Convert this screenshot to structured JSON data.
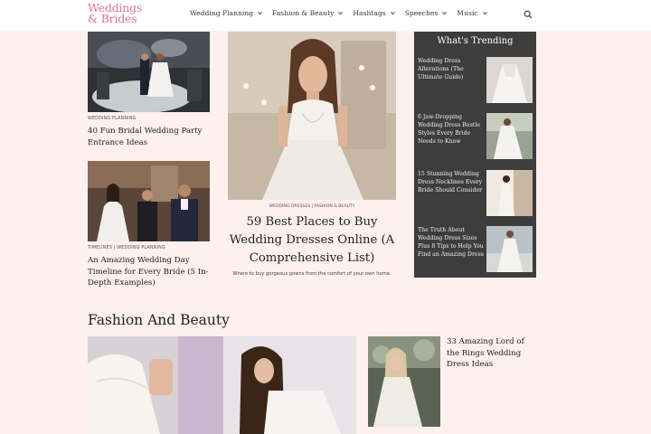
{
  "header": {
    "logo": "Weddings & Brides",
    "nav": [
      {
        "label": "Wedding Planning"
      },
      {
        "label": "Fashion & Beauty"
      },
      {
        "label": "Hashtags"
      },
      {
        "label": "Speeches"
      },
      {
        "label": "Music"
      }
    ],
    "search_icon": "search-icon"
  },
  "left_posts": [
    {
      "category": "WEDDING PLANNING",
      "title": "40 Fun Bridal Wedding Party Entrance Ideas"
    },
    {
      "category": "TIMELINES | WEDDING PLANNING",
      "title": "An Amazing Wedding Day Timeline for Every Bride (5 In-Depth Examples)"
    }
  ],
  "featured": {
    "category": "WEDDING DRESSES | FASHION & BEAUTY",
    "title": "59 Best Places to Buy Wedding Dresses Online (A Comprehensive List)",
    "description": "Where to buy gorgeous gowns from the comfort of your own home."
  },
  "trending": {
    "title": "What's Trending",
    "items": [
      {
        "title": "Wedding Dress Alterations (The Ultimate Guide)"
      },
      {
        "title": "6 Jaw-Dropping Wedding Dress Bustle Styles Every Bride Needs to Know"
      },
      {
        "title": "15 Stunning Wedding Dress Necklines Every Bride Should Consider"
      },
      {
        "title": "The Truth About Wedding Dress Sizes Plus 8 Tips to Help You Find an Amazing Dress"
      }
    ]
  },
  "fashion_section": {
    "heading": "Fashion And Beauty",
    "side_post_title": "33 Amazing Lord of the Rings Wedding Dress Ideas"
  },
  "colors": {
    "background": "#fdf0ee",
    "logo": "#e0768a",
    "trending_bg": "#3d3d3d"
  }
}
